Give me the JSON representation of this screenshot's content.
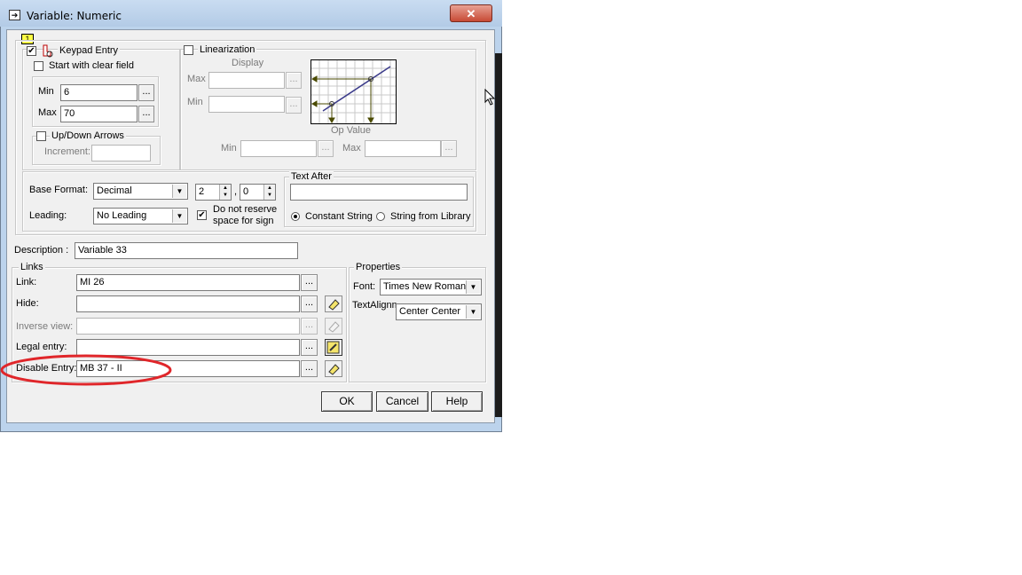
{
  "window": {
    "title": "Variable: Numeric",
    "close_glyph": "✕"
  },
  "tab_badge": "1",
  "keypad": {
    "label": "Keypad Entry",
    "checked": true,
    "start_clear_label": "Start with clear field",
    "min_label": "Min",
    "min_value": "6",
    "max_label": "Max",
    "max_value": "70",
    "updown_label": "Up/Down Arrows",
    "increment_label": "Increment:",
    "increment_value": ""
  },
  "linearization": {
    "label": "Linearization",
    "display_label": "Display",
    "max_label": "Max",
    "min_label": "Min",
    "op_value_label": "Op Value",
    "op_min_label": "Min",
    "op_max_label": "Max"
  },
  "format": {
    "base_format_label": "Base Format:",
    "base_format_value": "Decimal",
    "digits_left": "2",
    "digits_right": "0",
    "leading_label": "Leading:",
    "leading_value": "No Leading",
    "no_reserve_label_line1": "Do not reserve",
    "no_reserve_label_line2": "space for sign"
  },
  "text_after": {
    "label": "Text After",
    "value": "",
    "constant_string_label": "Constant String",
    "string_from_library_label": "String from Library"
  },
  "description": {
    "label": "Description :",
    "value": "Variable 33"
  },
  "links": {
    "label": "Links",
    "rows": [
      {
        "label": "Link:",
        "value": "MI 26"
      },
      {
        "label": "Hide:",
        "value": ""
      },
      {
        "label": "Inverse view:",
        "value": ""
      },
      {
        "label": "Legal entry:",
        "value": ""
      },
      {
        "label": "Disable Entry:",
        "value": "MB 37  - II"
      }
    ]
  },
  "properties": {
    "label": "Properties",
    "font_label": "Font:",
    "font_value": "Times New Roman",
    "text_align_label": "TextAlignm",
    "text_align_value": "Center Center"
  },
  "buttons": {
    "ok": "OK",
    "cancel": "Cancel",
    "help": "Help",
    "browse": "..."
  },
  "highlight_color": "#e0262a"
}
